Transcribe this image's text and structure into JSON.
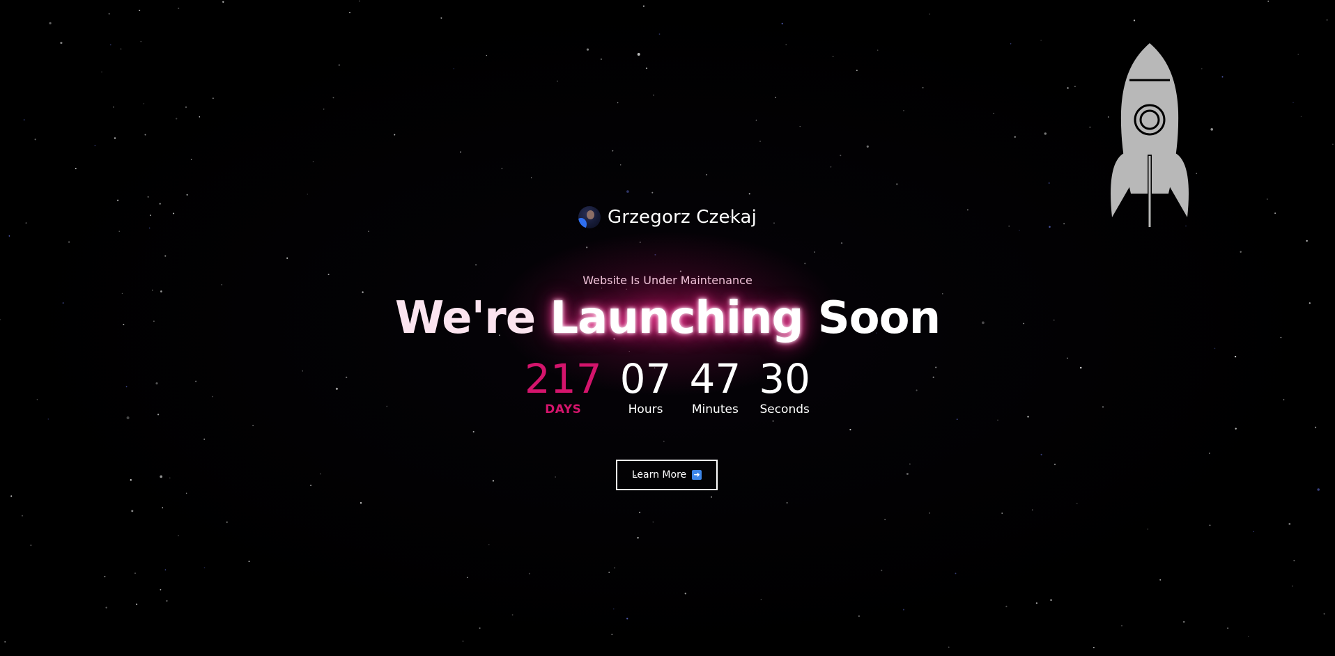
{
  "brand": {
    "name": "Grzegorz Czekaj",
    "avatar_icon": "avatar-photo"
  },
  "hero": {
    "tagline": "Website Is Under Maintenance",
    "headline_part1": "We're ",
    "headline_accent": "Launching",
    "headline_part2": " Soon"
  },
  "countdown": {
    "days": {
      "value": "217",
      "label": "DAYS"
    },
    "hours": {
      "value": "07",
      "label": "Hours"
    },
    "minutes": {
      "value": "47",
      "label": "Minutes"
    },
    "seconds": {
      "value": "30",
      "label": "Seconds"
    }
  },
  "cta": {
    "label": "Learn More",
    "icon": "arrow-right-icon"
  },
  "colors": {
    "background": "#000000",
    "accent": "#d4146c",
    "text": "#ffffff",
    "rocket": "#b8b8b8"
  }
}
